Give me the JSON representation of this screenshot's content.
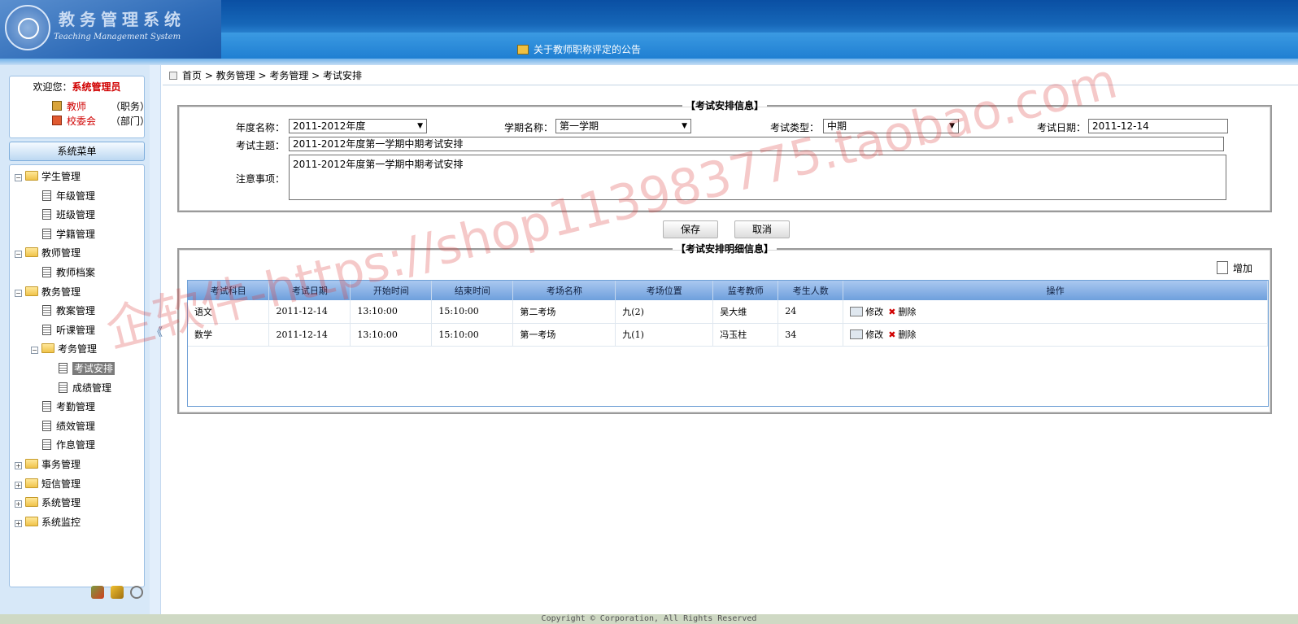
{
  "header": {
    "title": "教务管理系统",
    "subtitle": "Teaching Management System",
    "notice": "关于教师职称评定的公告"
  },
  "sidebar": {
    "welcome_label": "欢迎您：",
    "user_name": "系统管理员",
    "role_name": "教师",
    "role_desc": "（职务）",
    "dept_name": "校委会",
    "dept_desc": "（部门）",
    "menu_title": "系统菜单",
    "tree": [
      {
        "label": "学生管理",
        "type": "folder",
        "expanded": true,
        "level": 0
      },
      {
        "label": "年级管理",
        "type": "page",
        "level": 1
      },
      {
        "label": "班级管理",
        "type": "page",
        "level": 1
      },
      {
        "label": "学籍管理",
        "type": "page",
        "level": 1
      },
      {
        "label": "教师管理",
        "type": "folder",
        "expanded": true,
        "level": 0
      },
      {
        "label": "教师档案",
        "type": "page",
        "level": 1
      },
      {
        "label": "教务管理",
        "type": "folder",
        "expanded": true,
        "level": 0
      },
      {
        "label": "教案管理",
        "type": "page",
        "level": 1
      },
      {
        "label": "听课管理",
        "type": "page",
        "level": 1
      },
      {
        "label": "考务管理",
        "type": "folder",
        "expanded": true,
        "level": 1
      },
      {
        "label": "考试安排",
        "type": "page",
        "level": 2,
        "active": true
      },
      {
        "label": "成绩管理",
        "type": "page",
        "level": 2
      },
      {
        "label": "考勤管理",
        "type": "page",
        "level": 1
      },
      {
        "label": "绩效管理",
        "type": "page",
        "level": 1
      },
      {
        "label": "作息管理",
        "type": "page",
        "level": 1
      },
      {
        "label": "事务管理",
        "type": "folder",
        "expanded": false,
        "level": 0
      },
      {
        "label": "短信管理",
        "type": "folder",
        "expanded": false,
        "level": 0
      },
      {
        "label": "系统管理",
        "type": "folder",
        "expanded": false,
        "level": 0
      },
      {
        "label": "系统监控",
        "type": "folder",
        "expanded": false,
        "level": 0
      }
    ]
  },
  "breadcrumb": "首页 > 教务管理 > 考务管理 > 考试安排",
  "form": {
    "legend": "【考试安排信息】",
    "year_label": "年度名称：",
    "year_value": "2011-2012年度",
    "term_label": "学期名称：",
    "term_value": "第一学期",
    "type_label": "考试类型：",
    "type_value": "中期",
    "date_label": "考试日期：",
    "date_value": "2011-12-14",
    "topic_label": "考试主题：",
    "topic_value": "2011-2012年度第一学期中期考试安排",
    "notes_label": "注意事项：",
    "notes_value": "2011-2012年度第一学期中期考试安排",
    "save_label": "保存",
    "cancel_label": "取消"
  },
  "detail": {
    "legend": "【考试安排明细信息】",
    "add_label": "增加",
    "columns": [
      "考试科目",
      "考试日期",
      "开始时间",
      "结束时间",
      "考场名称",
      "考场位置",
      "监考教师",
      "考生人数",
      "操作"
    ],
    "rows": [
      [
        "语文",
        "2011-12-14",
        "13:10:00",
        "15:10:00",
        "第二考场",
        "九(2)",
        "吴大维",
        "24"
      ],
      [
        "数学",
        "2011-12-14",
        "13:10:00",
        "15:10:00",
        "第一考场",
        "九(1)",
        "冯玉柱",
        "34"
      ]
    ],
    "edit_label": "修改",
    "delete_label": "删除"
  },
  "footer": "Copyright © Corporation, All Rights Reserved",
  "watermark": "企软件-https://shop113983775.taobao.com"
}
